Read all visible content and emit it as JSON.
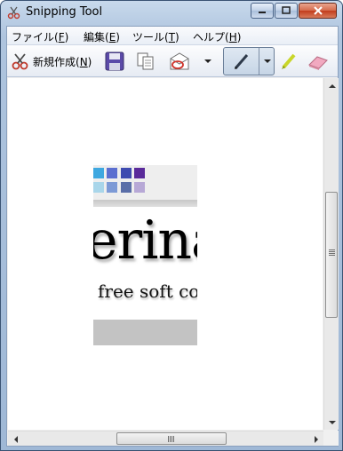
{
  "window": {
    "title": "Snipping Tool",
    "icon": "scissors-icon"
  },
  "caption_buttons": {
    "minimize_icon": "minimize-icon",
    "maximize_icon": "maximize-icon",
    "close_icon": "close-icon"
  },
  "menu": {
    "items": [
      {
        "label": "ファイル(F)",
        "text": "ファイル(",
        "key": "F",
        "end": ")"
      },
      {
        "label": "編集(E)",
        "text": "編集(",
        "key": "E",
        "end": ")"
      },
      {
        "label": "ツール(T)",
        "text": "ツール(",
        "key": "T",
        "end": ")"
      },
      {
        "label": "ヘルプ(H)",
        "text": "ヘルプ(",
        "key": "H",
        "end": ")"
      }
    ]
  },
  "toolbar": {
    "new_label": "新規作成(",
    "new_key": "N",
    "new_end": ")",
    "save_icon": "floppy-disk-icon",
    "copy_icon": "copy-icon",
    "send_icon": "envelope-icon",
    "pen_icon": "pen-icon",
    "highlighter_icon": "highlighter-icon",
    "eraser_icon": "eraser-icon"
  },
  "capture": {
    "big_text": "erina",
    "small_text": "free soft co",
    "swatch_colors": {
      "row1": [
        "#3fa8e0",
        "#5b6fd0",
        "#3e4bb0",
        "#5a2a9a"
      ],
      "row2": [
        "#a9d6ea",
        "#7d9ad6",
        "#5a6ea8",
        "#b7a8d6"
      ]
    }
  },
  "colors": {
    "frame": "#aec4de",
    "close_button": "#c23b1c",
    "canvas": "#ffffff"
  }
}
